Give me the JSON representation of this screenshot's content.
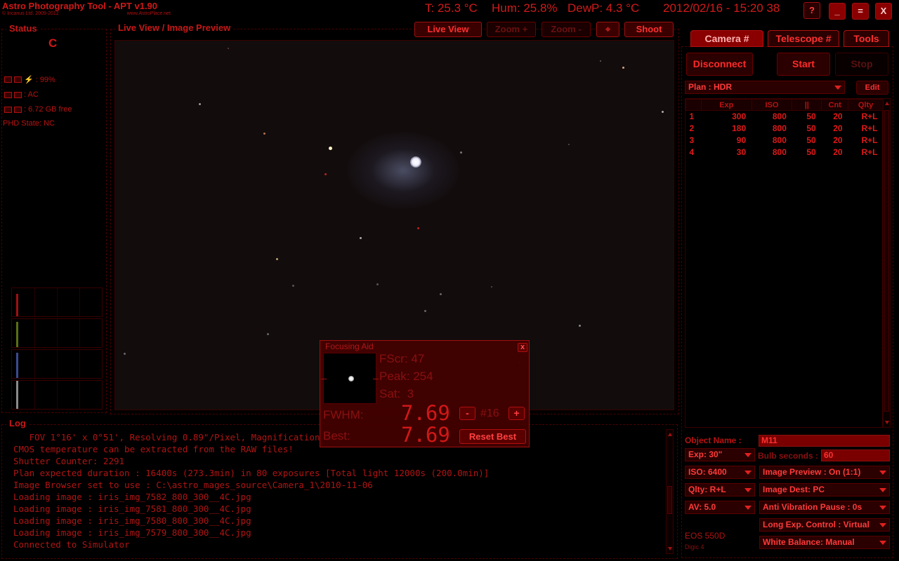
{
  "app": {
    "title": "Astro Photography Tool - APT v1.90",
    "copyright": "© Incanus Ltd. 2009-2012",
    "website": "www.AstroPlace.net"
  },
  "env": {
    "temp": "T: 25.3 °C",
    "hum": "Hum: 25.8%",
    "dewp": "DewP: 4.3 °C",
    "datetime": "2012/02/16 - 15:20 38"
  },
  "window_buttons": {
    "help": "?",
    "minimize": "_",
    "maximize": "=",
    "close": "X"
  },
  "status": {
    "title": "Status",
    "mode_letter": "C",
    "battery": ": 99%",
    "power": ": AC",
    "disk": ": 6.72 GB free",
    "phd": "PHD State: NC"
  },
  "liveview": {
    "title": "Live View / Image Preview",
    "buttons": {
      "live_view": "Live View",
      "zoom_in": "Zoom +",
      "zoom_out": "Zoom -",
      "shoot": "Shoot"
    }
  },
  "focusing_aid": {
    "title": "Focusing Aid",
    "close": "x",
    "fscr": "FScr: 47",
    "peak": "Peak: 254",
    "sat": "Sat:  3",
    "fwhm_label": "FWHM:",
    "fwhm_value": "7.69",
    "minus": "-",
    "count": "#16",
    "plus": "+",
    "best_label": "Best:",
    "best_value": "7.69",
    "reset_best": "Reset Best"
  },
  "log": {
    "title": "Log",
    "lines": [
      "   FOV 1°16' x 0°51', Resolving 0.89\"/Pixel, Magnification 38x",
      "CMOS temperature can be extracted from the RAW files!",
      "Shutter Counter: 2291",
      "Plan expected duration : 16400s (273.3min) in 80 exposures [Total light 12000s (200.0min)]",
      "Image Browser set to use : C:\\astro_mages_source\\Camera_1\\2010-11-06",
      "Loading image : iris_img_7582_800_300__4C.jpg",
      "Loading image : iris_img_7581_800_300__4C.jpg",
      "Loading image : iris_img_7580_800_300__4C.jpg",
      "Loading image : iris_img_7579_800_300__4C.jpg",
      "Connected to Simulator"
    ]
  },
  "tabs": {
    "camera": "Camera #",
    "telescope": "Telescope #",
    "tools": "Tools"
  },
  "controls": {
    "disconnect": "Disconnect",
    "start": "Start",
    "stop": "Stop"
  },
  "plan": {
    "selected": "Plan : HDR",
    "edit": "Edit",
    "columns": [
      "",
      "Exp",
      "ISO",
      "||",
      "Cnt",
      "Qlty"
    ],
    "rows": [
      [
        "1",
        "300",
        "800",
        "50",
        "20",
        "R+L"
      ],
      [
        "2",
        "180",
        "800",
        "50",
        "20",
        "R+L"
      ],
      [
        "3",
        "90",
        "800",
        "50",
        "20",
        "R+L"
      ],
      [
        "4",
        "30",
        "800",
        "50",
        "20",
        "R+L"
      ]
    ]
  },
  "settings": {
    "object_label": "Object Name :",
    "object_value": "M11",
    "exp": "Exp: 30\"",
    "bulb_label": "Bulb seconds :",
    "bulb_value": "60",
    "iso": "ISO: 6400",
    "image_preview": "Image Preview : On (1:1)",
    "qlty": "Qlty: R+L",
    "image_dest": "Image Dest: PC",
    "av": "AV: 5.0",
    "anti_vibration": "Anti Vibration Pause : 0s",
    "long_exp": "Long Exp. Control : Virtual",
    "white_balance": "White Balance: Manual",
    "camera_model": "EOS 550D",
    "camera_digic": "Digic 4"
  }
}
